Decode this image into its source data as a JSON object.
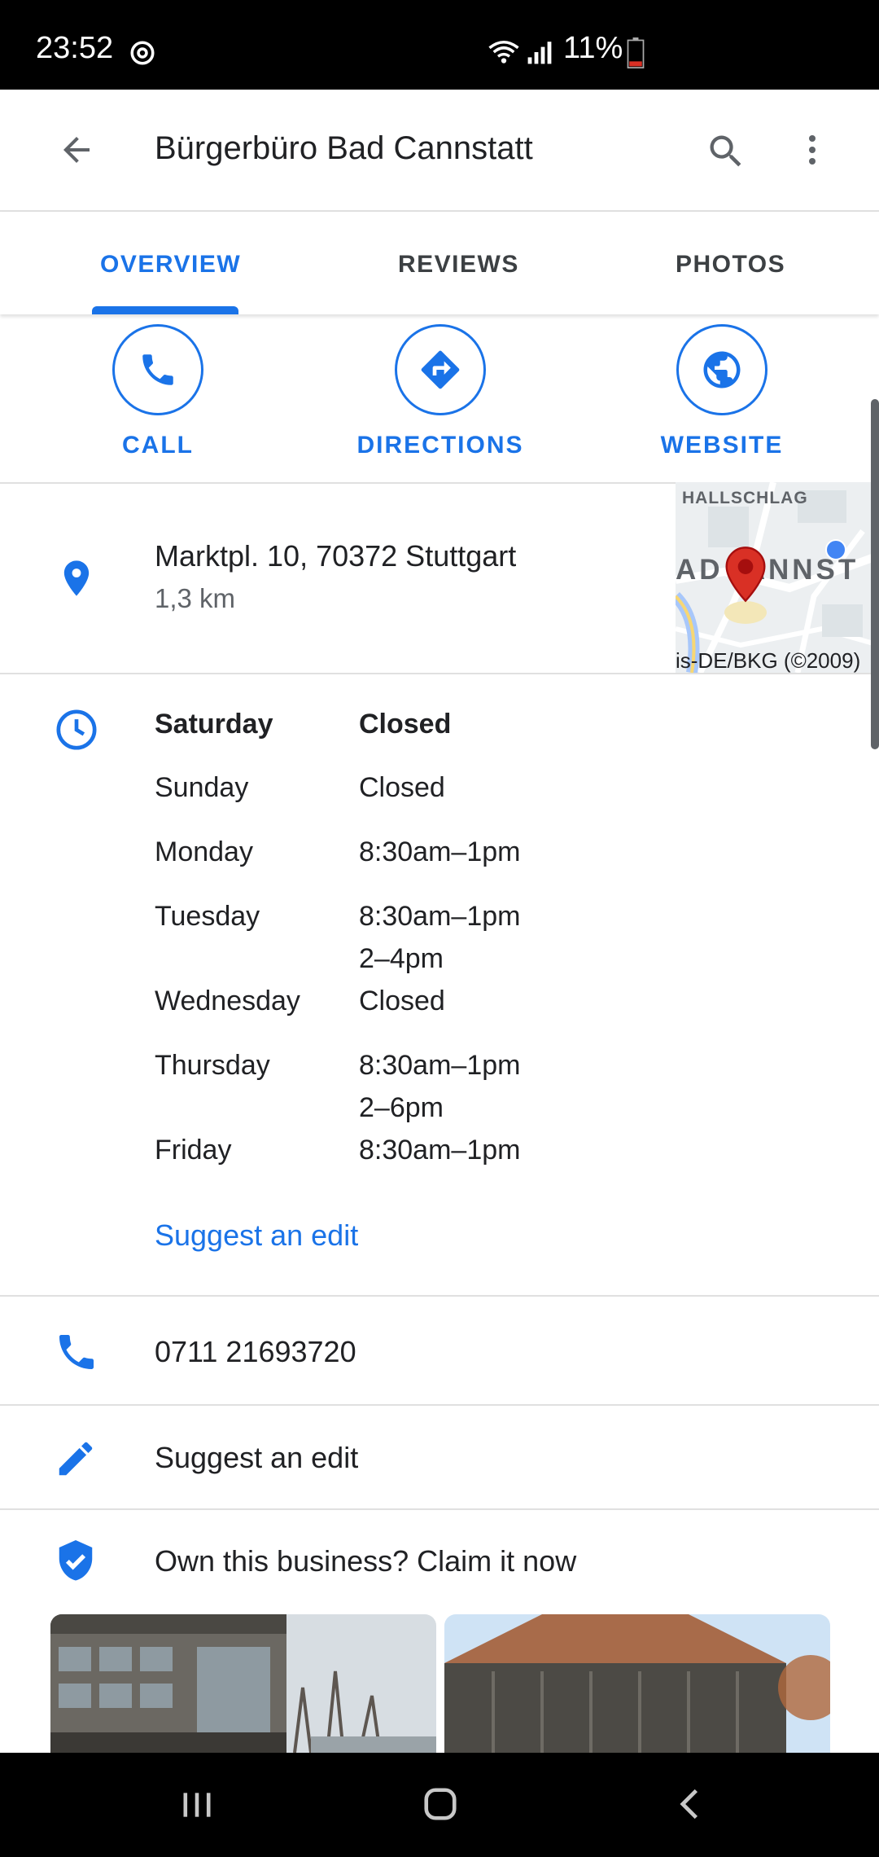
{
  "status_bar": {
    "time": "23:52",
    "battery": "11%"
  },
  "app_bar": {
    "title": "Bürgerbüro Bad Cannstatt"
  },
  "tabs": [
    {
      "label": "OVERVIEW",
      "active": true
    },
    {
      "label": "REVIEWS",
      "active": false
    },
    {
      "label": "PHOTOS",
      "active": false
    }
  ],
  "actions": {
    "call": "CALL",
    "directions": "DIRECTIONS",
    "website": "WEBSITE"
  },
  "address": {
    "line": "Marktpl. 10, 70372 Stuttgart",
    "distance": "1,3 km"
  },
  "map": {
    "label_top": "HALLSCHLAG",
    "label_mid": "AD  ANNST",
    "attribution": "is-DE/BKG (©2009)"
  },
  "hours": [
    {
      "day": "Saturday",
      "time": "Closed",
      "time2": ""
    },
    {
      "day": "Sunday",
      "time": "Closed",
      "time2": ""
    },
    {
      "day": "Monday",
      "time": "8:30am–1pm",
      "time2": ""
    },
    {
      "day": "Tuesday",
      "time": "8:30am–1pm",
      "time2": "2–4pm"
    },
    {
      "day": "Wednesday",
      "time": "Closed",
      "time2": ""
    },
    {
      "day": "Thursday",
      "time": "8:30am–1pm",
      "time2": "2–6pm"
    },
    {
      "day": "Friday",
      "time": "8:30am–1pm",
      "time2": ""
    }
  ],
  "suggest_edit_link": "Suggest an edit",
  "phone": "0711 21693720",
  "suggest_edit_row": "Suggest an edit",
  "claim": "Own this business? Claim it now",
  "colors": {
    "accent": "#1a73e8",
    "pin": "#d93025"
  }
}
